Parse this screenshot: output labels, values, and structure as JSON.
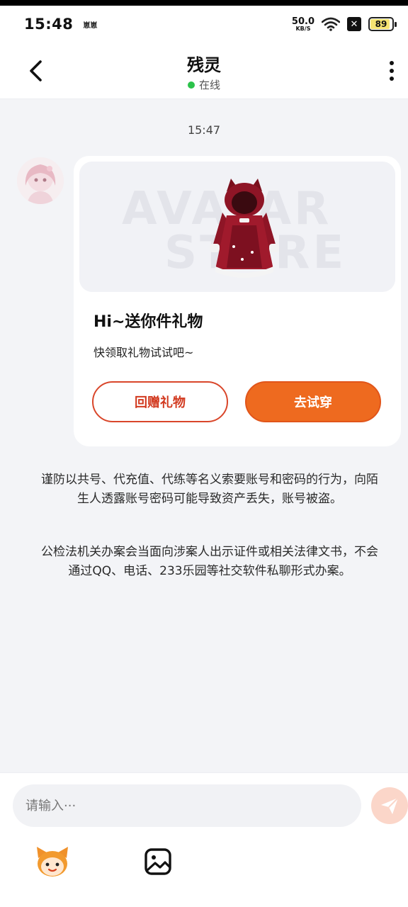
{
  "status_bar": {
    "time": "15:48",
    "extra": "崽崽",
    "net_speed_value": "50.0",
    "net_speed_unit": "KB/S",
    "battery": "89"
  },
  "header": {
    "title": "残灵",
    "status": "在线"
  },
  "chat": {
    "timestamp": "15:47",
    "gift_card": {
      "watermark_line1": "AVATAR",
      "watermark_line2": "STORE",
      "title": "Hi~送你件礼物",
      "subtitle": "快领取礼物试试吧~",
      "return_gift_label": "回赠礼物",
      "try_on_label": "去试穿"
    },
    "notice1": "谨防以共号、代充值、代练等名义索要账号和密码的行为，向陌生人透露账号密码可能导致资产丢失，账号被盗。",
    "notice2": "公检法机关办案会当面向涉案人出示证件或相关法律文书，不会通过QQ、电话、233乐园等社交软件私聊形式办案。"
  },
  "composer": {
    "placeholder": "请输入···"
  },
  "colors": {
    "accent": "#ee6a1f",
    "online": "#2bc24a",
    "background": "#f3f4f7"
  },
  "icons": {
    "back": "back-arrow-icon",
    "more": "more-vertical-icon",
    "send": "send-icon",
    "emoji": "emoji-icon",
    "image": "image-icon"
  }
}
